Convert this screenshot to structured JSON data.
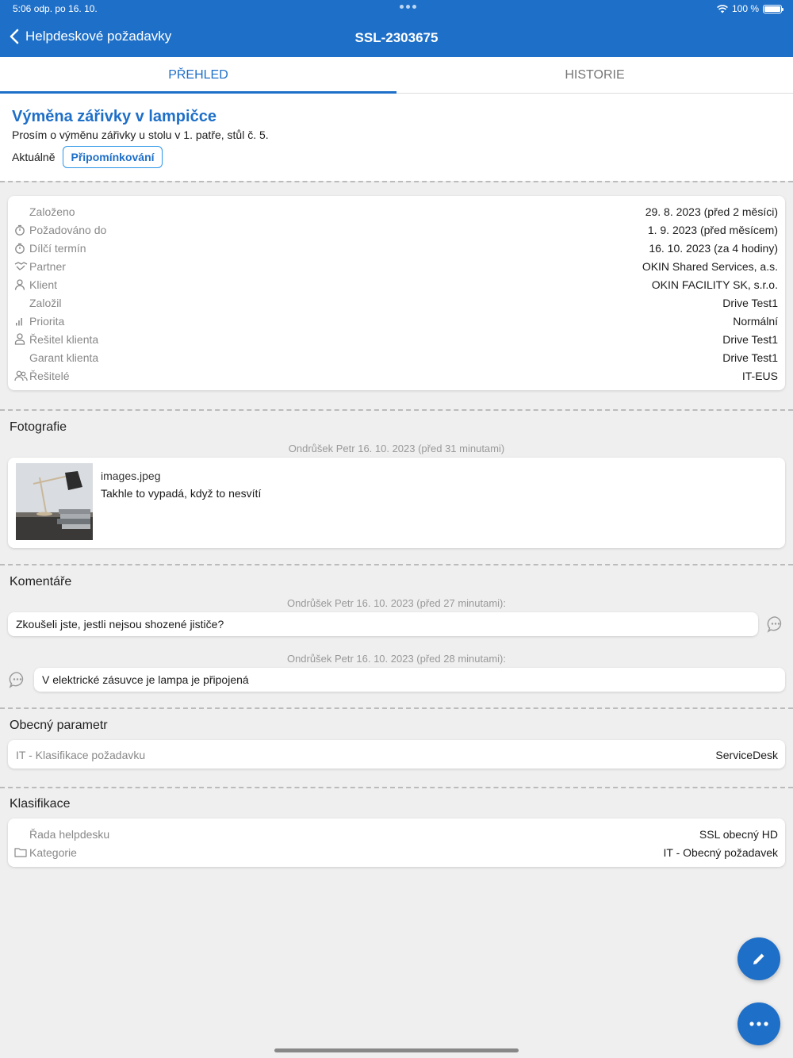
{
  "status": {
    "time": "5:06 odp.  po 16. 10.",
    "battery": "100 %"
  },
  "nav": {
    "back_label": "Helpdeskové požadavky",
    "title": "SSL-2303675"
  },
  "tabs": [
    {
      "label": "PŘEHLED",
      "active": true
    },
    {
      "label": "HISTORIE",
      "active": false
    }
  ],
  "request": {
    "title": "Výměna zářivky v lampičce",
    "description": "Prosím o výměnu zářivky u stolu v 1. patře, stůl č. 5.",
    "state_label": "Aktuálně",
    "state_badge": "Připomínkování"
  },
  "details": [
    {
      "key": "Založeno",
      "value": "29. 8. 2023 (před 2 měsíci)",
      "icon": ""
    },
    {
      "key": "Požadováno do",
      "value": "1. 9. 2023 (před měsícem)",
      "icon": "timer-icon"
    },
    {
      "key": "Dílčí termín",
      "value": "16. 10. 2023 (za 4 hodiny)",
      "icon": "timer-icon"
    },
    {
      "key": "Partner",
      "value": "OKIN Shared Services, a.s.",
      "icon": "handshake-icon"
    },
    {
      "key": "Klient",
      "value": "OKIN FACILITY SK, s.r.o.",
      "icon": "person-icon"
    },
    {
      "key": "Založil",
      "value": "Drive Test1",
      "icon": ""
    },
    {
      "key": "Priorita",
      "value": "Normální",
      "icon": "signal-bars-icon"
    },
    {
      "key": "Řešitel klienta",
      "value": "Drive Test1",
      "icon": "person-outline-icon"
    },
    {
      "key": "Garant klienta",
      "value": "Drive Test1",
      "icon": ""
    },
    {
      "key": "Řešitelé",
      "value": "IT-EUS",
      "icon": "people-icon"
    }
  ],
  "photos": {
    "section_title": "Fotografie",
    "meta": "Ondrůšek Petr 16. 10. 2023 (před 31 minutami)",
    "filename": "images.jpeg",
    "description": "Takhle to vypadá, když to nesvítí"
  },
  "comments": {
    "section_title": "Komentáře",
    "items": [
      {
        "meta": "Ondrůšek Petr  16. 10. 2023 (před 27 minutami):",
        "text": "Zkoušeli jste, jestli nejsou shozené jističe?"
      },
      {
        "meta": "Ondrůšek Petr  16. 10. 2023 (před 28 minutami):",
        "text": "V elektrické zásuvce je lampa je připojená"
      }
    ]
  },
  "general_param": {
    "section_title": "Obecný parametr",
    "key": "IT - Klasifikace požadavku",
    "value": "ServiceDesk"
  },
  "classification": {
    "section_title": "Klasifikace",
    "rows": [
      {
        "key": "Řada helpdesku",
        "value": "SSL obecný HD",
        "icon": ""
      },
      {
        "key": "Kategorie",
        "value": "IT - Obecný požadavek",
        "icon": "folder-icon"
      }
    ]
  },
  "colors": {
    "brand": "#1e6fc8",
    "background": "#efefef"
  }
}
